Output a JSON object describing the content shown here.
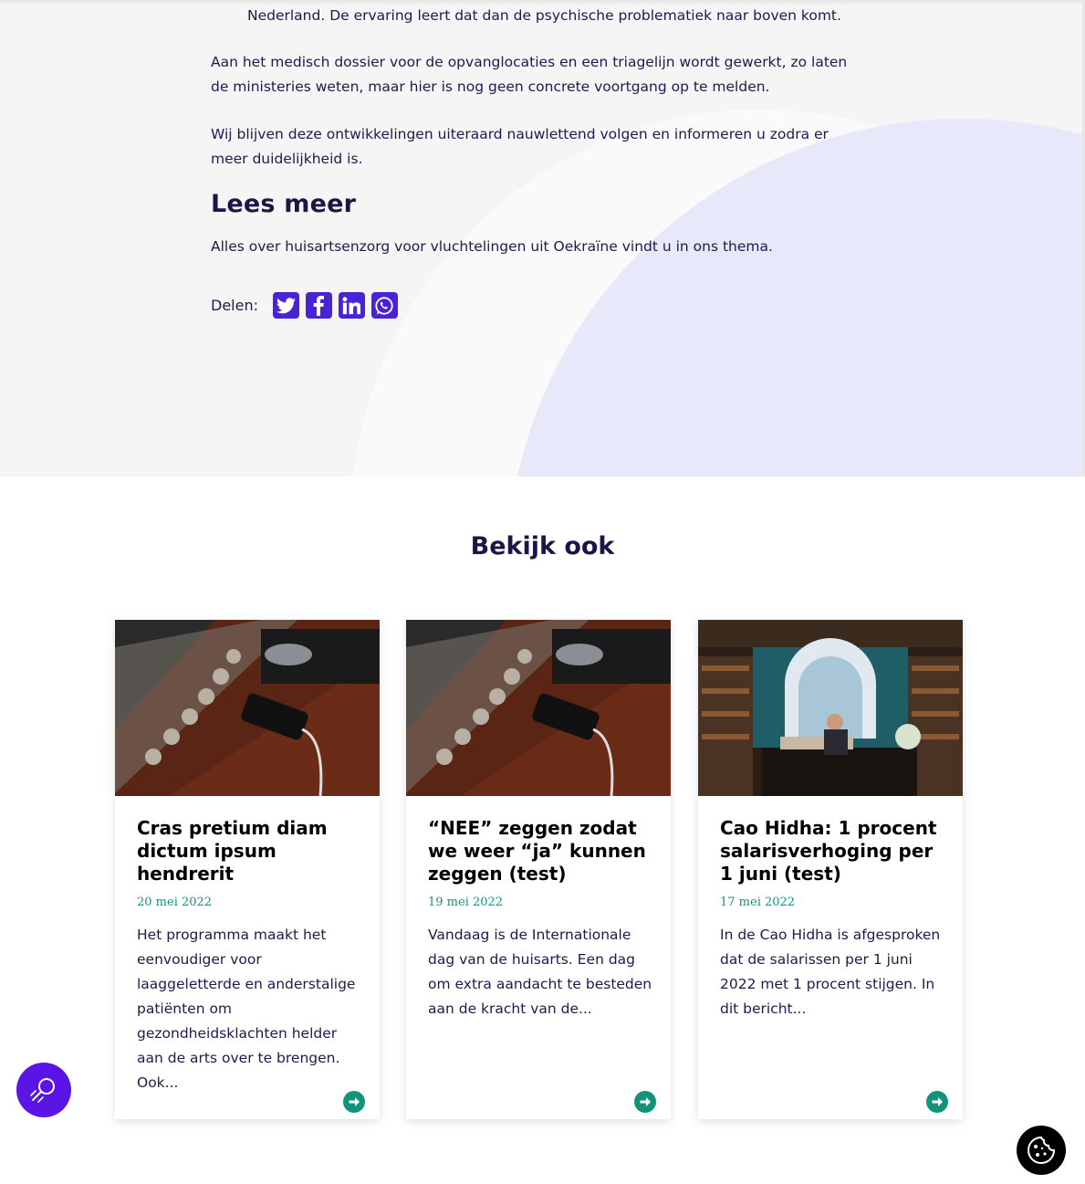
{
  "article": {
    "paragraph_tail": "Nederland. De ervaring leert dat dan de psychische problematiek naar boven komt.",
    "paragraph_2": "Aan het medisch dossier voor de opvanglocaties en een triagelijn wordt gewerkt, zo laten de ministeries weten, maar hier is nog geen concrete voortgang op te melden.",
    "paragraph_3": "Wij blijven deze ontwikkelingen uiteraard nauwlettend volgen en informeren u zodra er meer duidelijkheid is.",
    "heading": "Lees meer",
    "read_more_text": "Alles over huisartsenzorg voor vluchtelingen uit Oekraïne vindt u in ons thema.",
    "share_label": "Delen:",
    "share_icons": [
      "twitter-icon",
      "facebook-icon",
      "linkedin-icon",
      "whatsapp-icon"
    ]
  },
  "related": {
    "title": "Bekijk ook",
    "cards": [
      {
        "title": "Cras pretium diam dictum ipsum hendrerit",
        "date": "20 mei 2022",
        "excerpt": "Het programma maakt het eenvoudiger voor laaggeletterde en anderstalige patiënten om gezondheidsklachten helder aan de arts over te brengen. Ook...",
        "image": "record-player-phone-photo"
      },
      {
        "title": "“NEE” zeggen zodat we weer “ja” kunnen zeggen (test)￼",
        "date": "19 mei 2022",
        "excerpt": "Vandaag is de Internationale dag van de huisarts. Een dag om extra aandacht te besteden aan de kracht van de...",
        "image": "record-player-phone-photo"
      },
      {
        "title": "Cao Hidha: 1 procent salarisverhoging per 1 juni (test)￼",
        "date": "17 mei 2022",
        "excerpt": "In de Cao Hidha is afgesproken dat de salarissen per 1 juni 2022 met 1 procent stijgen. In dit bericht...",
        "image": "bookstore-photo"
      }
    ]
  },
  "floating": {
    "search_icon": "search-icon",
    "cookie_icon": "cookie-icon"
  },
  "colors": {
    "brand_purple": "#4b23d6",
    "fab_purple": "#5a14e6",
    "accent_green": "#13947a",
    "heading_navy": "#1a1747",
    "hero_bg": "#f5f5f5",
    "hero_circle": "#e8e8fb"
  }
}
